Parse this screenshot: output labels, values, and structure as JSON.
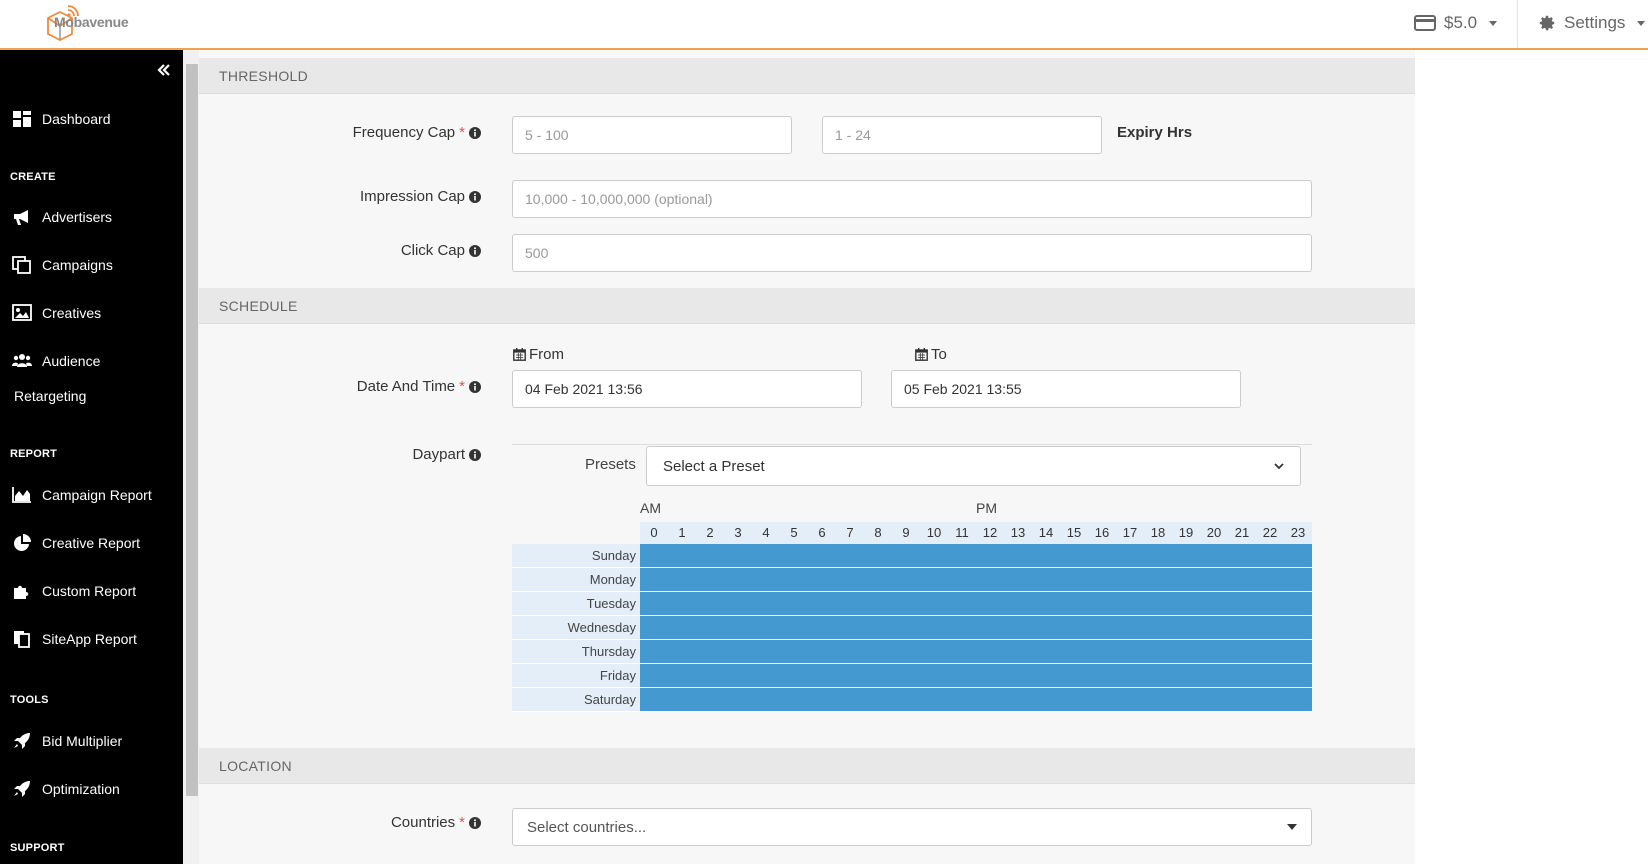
{
  "header": {
    "logo_text": "Mobavenue",
    "balance": "$5.0",
    "settings_label": "Settings"
  },
  "sidebar": {
    "items": {
      "dashboard": "Dashboard",
      "create_section": "CREATE",
      "advertisers": "Advertisers",
      "campaigns": "Campaigns",
      "creatives": "Creatives",
      "audience": "Audience",
      "retargeting": "Retargeting",
      "report_section": "REPORT",
      "campaign_report": "Campaign Report",
      "creative_report": "Creative Report",
      "custom_report": "Custom Report",
      "siteapp_report": "SiteApp Report",
      "tools_section": "TOOLS",
      "bid_multiplier": "Bid Multiplier",
      "optimization": "Optimization",
      "support_section": "SUPPORT"
    }
  },
  "threshold": {
    "title": "THRESHOLD",
    "frequency_cap_label": "Frequency Cap",
    "frequency_cap_placeholder": "5 - 100",
    "expiry_placeholder": "1 - 24",
    "expiry_label": "Expiry Hrs",
    "impression_cap_label": "Impression Cap",
    "impression_cap_placeholder": "10,000 - 10,000,000 (optional)",
    "click_cap_label": "Click Cap",
    "click_cap_placeholder": "500"
  },
  "schedule": {
    "title": "SCHEDULE",
    "date_time_label": "Date And Time",
    "from_label": "From",
    "to_label": "To",
    "from_value": "04 Feb 2021 13:56",
    "to_value": "05 Feb 2021 13:55",
    "daypart_label": "Daypart",
    "presets_label": "Presets",
    "preset_selected": "Select a Preset",
    "am_label": "AM",
    "pm_label": "PM",
    "hours": [
      "0",
      "1",
      "2",
      "3",
      "4",
      "5",
      "6",
      "7",
      "8",
      "9",
      "10",
      "11",
      "12",
      "13",
      "14",
      "15",
      "16",
      "17",
      "18",
      "19",
      "20",
      "21",
      "22",
      "23"
    ],
    "days": [
      "Sunday",
      "Monday",
      "Tuesday",
      "Wednesday",
      "Thursday",
      "Friday",
      "Saturday"
    ],
    "selected_color": "#4499d1"
  },
  "location": {
    "title": "LOCATION",
    "countries_label": "Countries",
    "countries_placeholder": "Select countries..."
  }
}
